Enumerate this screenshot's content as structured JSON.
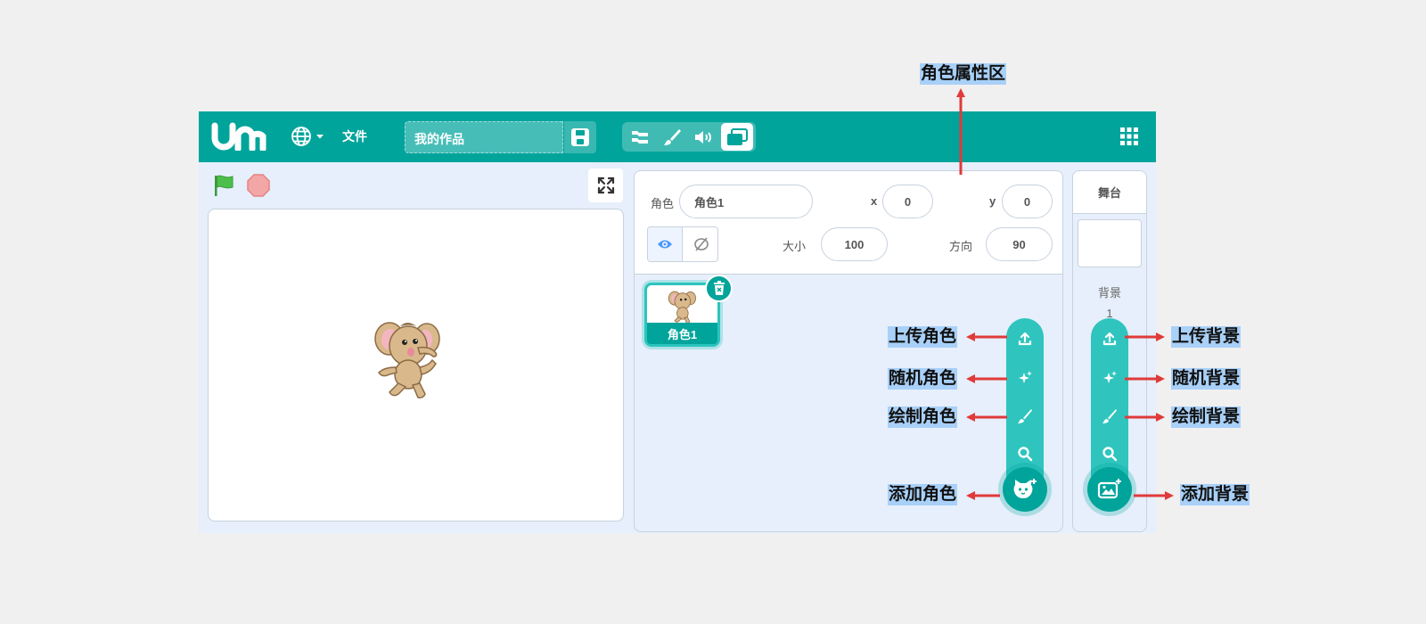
{
  "menubar": {
    "file_label": "文件",
    "project_title": "我的作品"
  },
  "sprite_props": {
    "sprite_label": "角色",
    "sprite_name_value": "角色1",
    "x_label": "x",
    "x_value": "0",
    "y_label": "y",
    "y_value": "0",
    "size_label": "大小",
    "size_value": "100",
    "direction_label": "方向",
    "direction_value": "90"
  },
  "sprites": [
    {
      "name": "角色1"
    }
  ],
  "stage_panel": {
    "title": "舞台",
    "backdrop_label": "背景",
    "backdrop_count": "1"
  },
  "annotations": {
    "sprite_props_area": "角色属性区",
    "upload_sprite": "上传角色",
    "random_sprite": "随机角色",
    "paint_sprite": "绘制角色",
    "add_sprite": "添加角色",
    "upload_backdrop": "上传背景",
    "random_backdrop": "随机背景",
    "paint_backdrop": "绘制背景",
    "add_backdrop": "添加背景"
  },
  "colors": {
    "brand_teal": "#00a49b",
    "fab_teal": "#2fc5be",
    "annotation_arrow": "#e03a3a",
    "annotation_highlight": "#a8d0f8"
  },
  "icons": [
    "logo",
    "globe-icon",
    "save-icon",
    "code-tab-icon",
    "costume-tab-icon",
    "sound-tab-icon",
    "stage-tab-icon",
    "grid-menu-icon",
    "green-flag-icon",
    "stop-icon",
    "fullscreen-icon",
    "eye-icon",
    "eye-slash-icon",
    "trash-icon",
    "upload-icon",
    "sparkle-icon",
    "brush-icon",
    "search-icon",
    "cat-plus-icon",
    "image-plus-icon"
  ]
}
